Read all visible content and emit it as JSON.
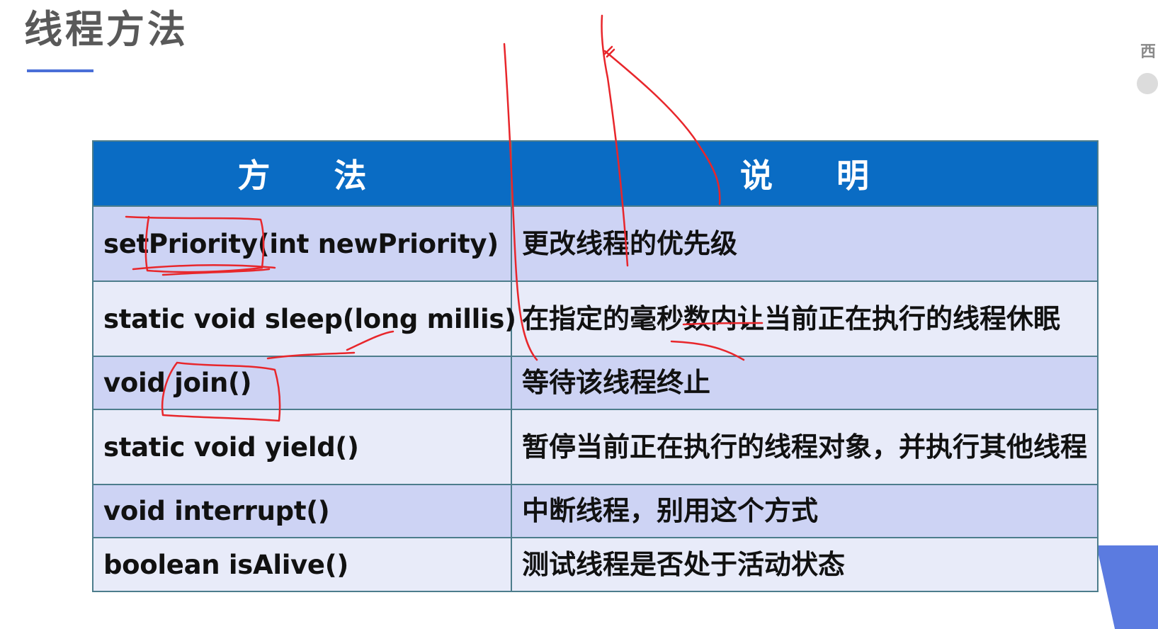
{
  "slide": {
    "title": "线程方法",
    "side_char": "西"
  },
  "table": {
    "headers": [
      "方",
      "法",
      "说",
      "明"
    ],
    "rows": [
      {
        "method": "setPriority(int  newPriority)",
        "description": "更改线程的优先级"
      },
      {
        "method": "static void sleep(long millis)",
        "description": "在指定的毫秒数内让当前正在执行的线程休眠"
      },
      {
        "method": "void join()",
        "description": "等待该线程终止"
      },
      {
        "method": "static void yield()",
        "description": "暂停当前正在执行的线程对象，并执行其他线程"
      },
      {
        "method": "void interrupt()",
        "description": "中断线程，别用这个方式"
      },
      {
        "method": "boolean isAlive()",
        "description": "测试线程是否处于活动状态"
      }
    ]
  },
  "colors": {
    "header_bg": "#0a6cc4",
    "row_odd": "#cdd3f4",
    "row_even": "#e8ebf9",
    "annotation_ink": "#e8262b",
    "accent": "#4a6fd8"
  }
}
